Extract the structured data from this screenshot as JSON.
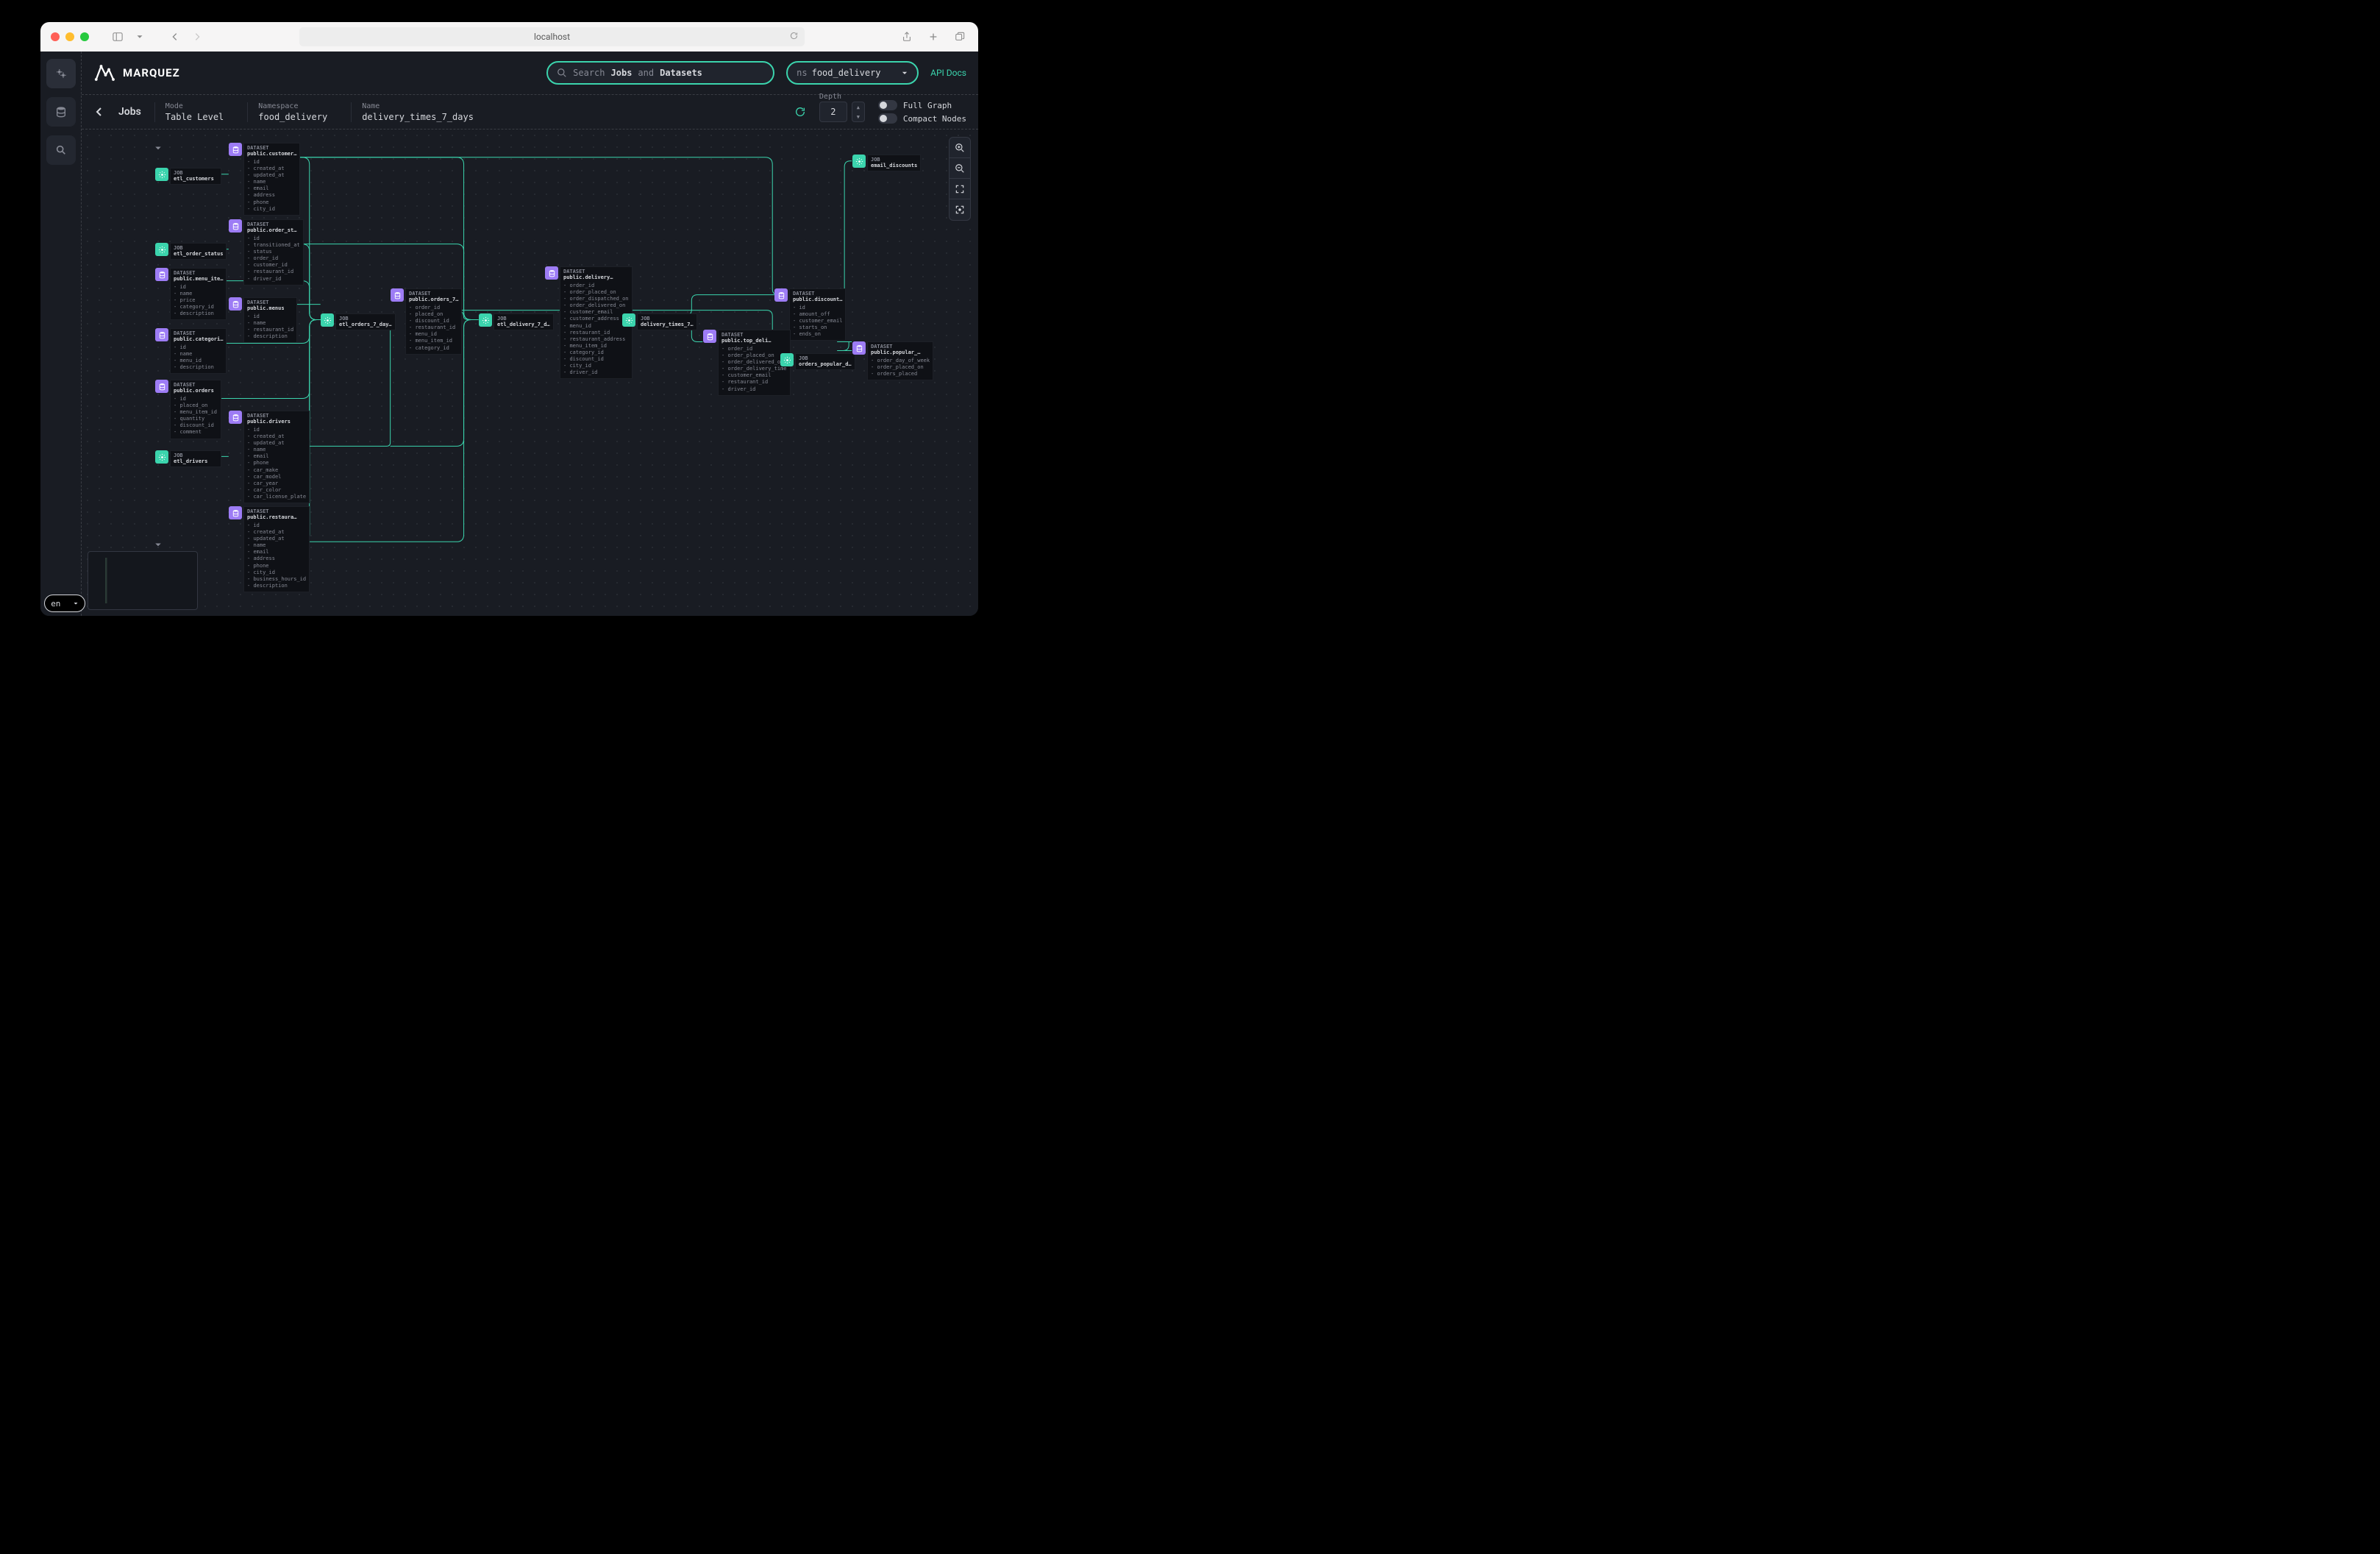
{
  "browser": {
    "url": "localhost"
  },
  "app": {
    "brand": "MARQUEZ",
    "search": {
      "placeholder_prefix": "Search ",
      "jobs_word": "Jobs",
      "and_word": " and ",
      "datasets_word": "Datasets"
    },
    "namespace_selector": {
      "label": "ns",
      "value": "food_delivery"
    },
    "api_docs": "API Docs"
  },
  "breadcrumb": {
    "title": "Jobs",
    "mode_label": "Mode",
    "mode_value": "Table Level",
    "namespace_label": "Namespace",
    "namespace_value": "food_delivery",
    "name_label": "Name",
    "name_value": "delivery_times_7_days",
    "depth_label": "Depth",
    "depth_value": "2",
    "toggle_full": "Full Graph",
    "toggle_compact": "Compact Nodes"
  },
  "lang": "en",
  "labels": {
    "job": "JOB",
    "dataset": "DATASET"
  },
  "nodes": {
    "etl_customers": {
      "type": "JOB",
      "name": "etl_customers"
    },
    "etl_order_status": {
      "type": "JOB",
      "name": "etl_order_status"
    },
    "etl_drivers": {
      "type": "JOB",
      "name": "etl_drivers"
    },
    "etl_orders_7": {
      "type": "JOB",
      "name": "etl_orders_7_day…"
    },
    "etl_delivery_7": {
      "type": "JOB",
      "name": "etl_delivery_7_d…"
    },
    "delivery_times_7": {
      "type": "JOB",
      "name": "delivery_times_7…"
    },
    "email_discounts": {
      "type": "JOB",
      "name": "email_discounts"
    },
    "orders_popular": {
      "type": "JOB",
      "name": "orders_popular_d…"
    },
    "ds_customers": {
      "type": "DATASET",
      "name": "public.customer…",
      "fields": [
        "id",
        "created_at",
        "updated_at",
        "name",
        "email",
        "address",
        "phone",
        "city_id"
      ]
    },
    "ds_order_st": {
      "type": "DATASET",
      "name": "public.order_st…",
      "fields": [
        "id",
        "transitioned_at",
        "status",
        "order_id",
        "customer_id",
        "restaurant_id",
        "driver_id"
      ]
    },
    "ds_menu_ite": {
      "type": "DATASET",
      "name": "public.menu_ite…",
      "fields": [
        "id",
        "name",
        "price",
        "category_id",
        "description"
      ]
    },
    "ds_menus": {
      "type": "DATASET",
      "name": "public.menus",
      "fields": [
        "id",
        "name",
        "restaurant_id",
        "description"
      ]
    },
    "ds_categori": {
      "type": "DATASET",
      "name": "public.categori…",
      "fields": [
        "id",
        "name",
        "menu_id",
        "description"
      ]
    },
    "ds_orders": {
      "type": "DATASET",
      "name": "public.orders",
      "fields": [
        "id",
        "placed_on",
        "menu_item_id",
        "quantity",
        "discount_id",
        "comment"
      ]
    },
    "ds_drivers": {
      "type": "DATASET",
      "name": "public.drivers",
      "fields": [
        "id",
        "created_at",
        "updated_at",
        "name",
        "email",
        "phone",
        "car_make",
        "car_model",
        "car_year",
        "car_color",
        "car_license_plate"
      ]
    },
    "ds_restaura": {
      "type": "DATASET",
      "name": "public.restaura…",
      "fields": [
        "id",
        "created_at",
        "updated_at",
        "name",
        "email",
        "address",
        "phone",
        "city_id",
        "business_hours_id",
        "description"
      ]
    },
    "ds_orders_7": {
      "type": "DATASET",
      "name": "public.orders_7…",
      "fields": [
        "order_id",
        "placed_on",
        "discount_id",
        "restaurant_id",
        "menu_id",
        "menu_item_id",
        "category_id"
      ]
    },
    "ds_delivery": {
      "type": "DATASET",
      "name": "public.delivery…",
      "fields": [
        "order_id",
        "order_placed_on",
        "order_dispatched_on",
        "order_delivered_on",
        "customer_email",
        "customer_address",
        "menu_id",
        "restaurant_id",
        "restaurant_address",
        "menu_item_id",
        "category_id",
        "discount_id",
        "city_id",
        "driver_id"
      ]
    },
    "ds_discount": {
      "type": "DATASET",
      "name": "public.discount…",
      "fields": [
        "id",
        "amount_off",
        "customer_email",
        "starts_on",
        "ends_on"
      ]
    },
    "ds_top_deli": {
      "type": "DATASET",
      "name": "public.top_deli…",
      "fields": [
        "order_id",
        "order_placed_on",
        "order_delivered_on",
        "order_delivery_time",
        "customer_email",
        "restaurant_id",
        "driver_id"
      ]
    },
    "ds_popular": {
      "type": "DATASET",
      "name": "public.popular_…",
      "fields": [
        "order_day_of_week",
        "order_placed_on",
        "orders_placed"
      ]
    }
  }
}
